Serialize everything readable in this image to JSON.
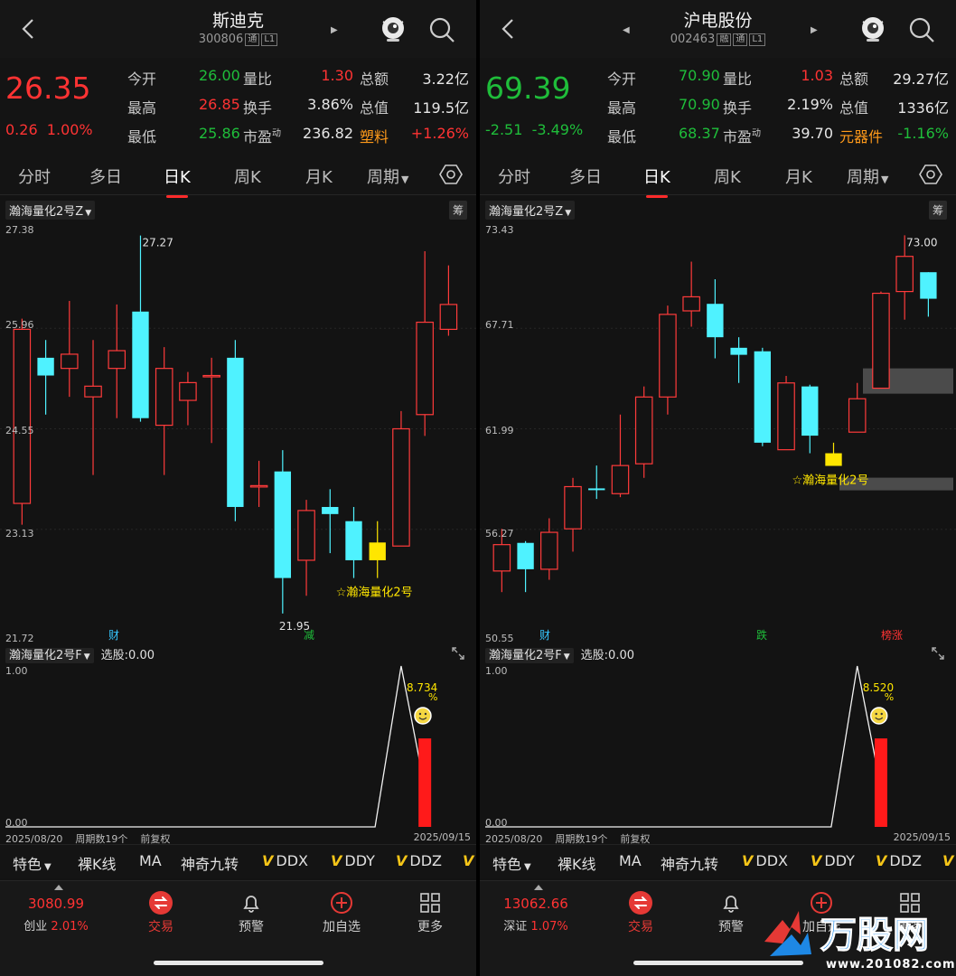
{
  "panels": [
    {
      "title": "斯迪克",
      "code": "300806",
      "tags": [
        "通",
        "L1"
      ],
      "price": "26.35",
      "change": "0.26",
      "change_pct": "1.00%",
      "price_color": "up",
      "quote": {
        "open_label": "今开",
        "open": "26.00",
        "open_color": "down",
        "high_label": "最高",
        "high": "26.85",
        "high_color": "up",
        "low_label": "最低",
        "low": "25.86",
        "low_color": "down",
        "vol_ratio_label": "量比",
        "vol_ratio": "1.30",
        "vol_ratio_color": "up",
        "turnover_label": "换手",
        "turnover": "3.86%",
        "pe_label": "市盈",
        "pe_sup": "动",
        "pe": "236.82",
        "amount_label": "总额",
        "amount": "3.22亿",
        "mktcap_label": "总值",
        "mktcap": "119.5亿",
        "sector": "塑料",
        "sector_chg": "+1.26%",
        "sector_chg_color": "up"
      },
      "tabs": [
        "分时",
        "多日",
        "日K",
        "周K",
        "月K",
        "周期"
      ],
      "active_tab": 2,
      "chart_title": "瀚海量化2号Z",
      "chip": "筹",
      "y_labels": [
        "27.38",
        "25.96",
        "24.55",
        "23.13",
        "21.72"
      ],
      "high_mark": "27.27",
      "low_mark": "21.95",
      "signal_label": "☆瀚海量化2号",
      "event_tags": [
        {
          "text": "财",
          "color": "#36c6ff"
        },
        {
          "text": "减",
          "color": "#1fbd3a"
        }
      ],
      "indicator": {
        "name": "瀚海量化2号F",
        "selected": "选股:0.00",
        "top": "1.00",
        "bottom": "0.00",
        "pct": "8.734",
        "pct_unit": "%"
      },
      "date_start": "2025/08/20",
      "period_info": "周期数19个",
      "adjust": "前复权",
      "date_end": "2025/09/15",
      "strip": [
        "特色",
        "裸K线",
        "MA",
        "神奇九转",
        "DDX",
        "DDY",
        "DDZ"
      ],
      "index": {
        "value": "3080.99",
        "name": "创业",
        "pct": "2.01%"
      },
      "bottom_nav": [
        "交易",
        "预警",
        "加自选",
        "更多"
      ]
    },
    {
      "title": "沪电股份",
      "code": "002463",
      "tags": [
        "融",
        "通",
        "L1"
      ],
      "price": "69.39",
      "change": "-2.51",
      "change_pct": "-3.49%",
      "price_color": "down",
      "quote": {
        "open_label": "今开",
        "open": "70.90",
        "open_color": "down",
        "high_label": "最高",
        "high": "70.90",
        "high_color": "down",
        "low_label": "最低",
        "low": "68.37",
        "low_color": "down",
        "vol_ratio_label": "量比",
        "vol_ratio": "1.03",
        "vol_ratio_color": "up",
        "turnover_label": "换手",
        "turnover": "2.19%",
        "pe_label": "市盈",
        "pe_sup": "动",
        "pe": "39.70",
        "amount_label": "总额",
        "amount": "29.27亿",
        "mktcap_label": "总值",
        "mktcap": "1336亿",
        "sector": "元器件",
        "sector_chg": "-1.16%",
        "sector_chg_color": "down"
      },
      "tabs": [
        "分时",
        "多日",
        "日K",
        "周K",
        "月K",
        "周期"
      ],
      "active_tab": 2,
      "chart_title": "瀚海量化2号Z",
      "chip": "筹",
      "y_labels": [
        "73.43",
        "67.71",
        "61.99",
        "56.27",
        "50.55"
      ],
      "high_mark": "73.00",
      "low_mark": "",
      "signal_label": "☆瀚海量化2号",
      "event_tags": [
        {
          "text": "财",
          "color": "#36c6ff"
        },
        {
          "text": "跌",
          "color": "#1fbd3a"
        },
        {
          "text": "榜涨",
          "color": "#ff3333"
        }
      ],
      "indicator": {
        "name": "瀚海量化2号F",
        "selected": "选股:0.00",
        "top": "1.00",
        "bottom": "0.00",
        "pct": "8.520",
        "pct_unit": "%"
      },
      "date_start": "2025/08/20",
      "period_info": "周期数19个",
      "adjust": "前复权",
      "date_end": "2025/09/15",
      "strip": [
        "特色",
        "裸K线",
        "MA",
        "神奇九转",
        "DDX",
        "DDY",
        "DDZ"
      ],
      "index": {
        "value": "13062.66",
        "name": "深证",
        "pct": "1.07%"
      },
      "bottom_nav": [
        "交易",
        "预警",
        "加自选",
        "更多"
      ]
    }
  ],
  "watermark": {
    "brand": "万股网",
    "url": "www.201082.com"
  },
  "chart_data": [
    {
      "type": "candlestick",
      "title": "斯迪克 日K",
      "ylim": [
        21.72,
        27.38
      ],
      "x": [
        "d1",
        "d2",
        "d3",
        "d4",
        "d5",
        "d6",
        "d7",
        "d8",
        "d9",
        "d10",
        "d11",
        "d12",
        "d13",
        "d14",
        "d15",
        "d16",
        "d17",
        "d18",
        "d19",
        "d20"
      ],
      "candles": [
        {
          "o": 23.5,
          "c": 25.95,
          "h": 26.1,
          "l": 23.2
        },
        {
          "o": 25.55,
          "c": 25.3,
          "h": 25.8,
          "l": 24.75
        },
        {
          "o": 25.4,
          "c": 25.6,
          "h": 26.35,
          "l": 25.0
        },
        {
          "o": 25.0,
          "c": 25.15,
          "h": 25.8,
          "l": 23.9
        },
        {
          "o": 25.4,
          "c": 25.65,
          "h": 26.3,
          "l": 24.7
        },
        {
          "o": 26.2,
          "c": 24.7,
          "h": 27.27,
          "l": 24.65
        },
        {
          "o": 24.6,
          "c": 25.4,
          "h": 25.7,
          "l": 23.9
        },
        {
          "o": 24.95,
          "c": 25.2,
          "h": 25.35,
          "l": 24.6
        },
        {
          "o": 25.3,
          "c": 25.3,
          "h": 25.55,
          "l": 24.35
        },
        {
          "o": 25.55,
          "c": 23.45,
          "h": 25.8,
          "l": 23.25
        },
        {
          "o": 23.75,
          "c": 23.75,
          "h": 24.1,
          "l": 23.45
        },
        {
          "o": 23.95,
          "c": 22.45,
          "h": 24.25,
          "l": 21.95
        },
        {
          "o": 22.7,
          "c": 23.4,
          "h": 23.55,
          "l": 22.2
        },
        {
          "o": 23.45,
          "c": 23.35,
          "h": 23.7,
          "l": 22.8
        },
        {
          "o": 23.25,
          "c": 22.7,
          "h": 23.45,
          "l": 22.45
        },
        {
          "o": 22.7,
          "c": 22.95,
          "h": 23.25,
          "l": 22.45
        },
        {
          "o": 22.9,
          "c": 24.55,
          "h": 24.8,
          "l": 22.9
        },
        {
          "o": 24.75,
          "c": 26.05,
          "h": 27.05,
          "l": 24.45
        },
        {
          "o": 25.95,
          "c": 26.3,
          "h": 26.85,
          "l": 25.86
        }
      ],
      "signal_index": 15,
      "indicator": {
        "pct": 8.734,
        "spike_index": 16,
        "bar_index": 17,
        "bar_value": 0.55
      }
    },
    {
      "type": "candlestick",
      "title": "沪电股份 日K",
      "ylim": [
        50.55,
        73.43
      ],
      "candles": [
        {
          "o": 53.9,
          "c": 55.4,
          "h": 56.3,
          "l": 52.7
        },
        {
          "o": 55.5,
          "c": 54.0,
          "h": 55.6,
          "l": 52.7
        },
        {
          "o": 54.0,
          "c": 56.1,
          "h": 56.9,
          "l": 53.4
        },
        {
          "o": 56.3,
          "c": 58.7,
          "h": 59.2,
          "l": 55.0
        },
        {
          "o": 58.6,
          "c": 58.5,
          "h": 59.9,
          "l": 58.0
        },
        {
          "o": 58.3,
          "c": 59.9,
          "h": 62.8,
          "l": 58.1
        },
        {
          "o": 60.0,
          "c": 63.8,
          "h": 64.4,
          "l": 59.2
        },
        {
          "o": 63.8,
          "c": 68.5,
          "h": 69.0,
          "l": 62.8
        },
        {
          "o": 68.7,
          "c": 69.5,
          "h": 71.5,
          "l": 67.8
        },
        {
          "o": 69.1,
          "c": 67.2,
          "h": 70.5,
          "l": 66.0
        },
        {
          "o": 66.6,
          "c": 66.2,
          "h": 67.2,
          "l": 64.6
        },
        {
          "o": 66.4,
          "c": 61.2,
          "h": 66.6,
          "l": 61.0
        },
        {
          "o": 60.8,
          "c": 64.6,
          "h": 65.0,
          "l": 60.8
        },
        {
          "o": 64.4,
          "c": 61.6,
          "h": 64.5,
          "l": 60.6
        },
        {
          "o": 60.6,
          "c": 60.6,
          "h": 61.2,
          "l": 60.1
        },
        {
          "o": 61.8,
          "c": 63.7,
          "h": 64.6,
          "l": 61.8
        },
        {
          "o": 64.3,
          "c": 69.7,
          "h": 69.8,
          "l": 64.3
        },
        {
          "o": 69.8,
          "c": 71.8,
          "h": 73.0,
          "l": 68.2
        },
        {
          "o": 70.9,
          "c": 69.39,
          "h": 70.9,
          "l": 68.37
        }
      ],
      "signal_index": 14,
      "indicator": {
        "pct": 8.52,
        "spike_index": 15,
        "bar_index": 16,
        "bar_value": 0.55
      }
    }
  ]
}
